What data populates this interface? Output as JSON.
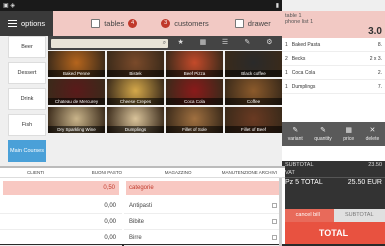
{
  "topnav": {
    "options": "options",
    "tables": "tables",
    "customers": "customers",
    "drawer": "drawer",
    "tables_badge": "4",
    "customers_badge": "3"
  },
  "categories": [
    "Beer",
    "Dessert",
    "Drink",
    "Fish",
    "Main Courses"
  ],
  "products": [
    {
      "label": "Baked Penne",
      "color": "#b5651d"
    },
    {
      "label": "Bistek",
      "color": "#7a4a2a"
    },
    {
      "label": "Beef Pizza",
      "color": "#c44a2a"
    },
    {
      "label": "Black coffee",
      "color": "#2a2a2a"
    },
    {
      "label": "Chateau de Mercurey",
      "color": "#5a1a1a"
    },
    {
      "label": "Cheese Crepes",
      "color": "#d4a84a"
    },
    {
      "label": "Coca Cola",
      "color": "#8a1a1a"
    },
    {
      "label": "Coffee",
      "color": "#8b5a2b"
    },
    {
      "label": "Dry Sparkling Wine",
      "color": "#c9b48a"
    },
    {
      "label": "Dumplings",
      "color": "#d9c39a"
    },
    {
      "label": "Fillet of Sole",
      "color": "#a07040"
    },
    {
      "label": "Fillet of Beef",
      "color": "#6a3a22"
    }
  ],
  "receipt": {
    "table": "table 1",
    "phone": "phone list 1",
    "total_top": "3.0",
    "items": [
      {
        "qty": "1",
        "name": "Baked Pasta",
        "price": "8."
      },
      {
        "qty": "2",
        "name": "Becks",
        "price": "2 x 3."
      },
      {
        "qty": "1",
        "name": "Coca Cola",
        "price": "2."
      },
      {
        "qty": "1",
        "name": "Dumplings",
        "price": "7."
      }
    ],
    "actions": [
      "variant",
      "quantity",
      "price",
      "delete"
    ],
    "subtotal_label": "SUBTOTAL",
    "subtotal_value": "23.50",
    "vat_label": "VAT",
    "total_label": "Pz 5 TOTAL",
    "total_value": "25.50 EUR",
    "cancel_bill": "cancel bill",
    "subtotal_btn": "SUBTOTAL",
    "total_btn": "TOTAL"
  },
  "laptop": {
    "headers": [
      "CLIENTI",
      "BUONI PASTO",
      "MAGAZZINO",
      "MANUTENZIONE ARCHIVI"
    ],
    "search_value": "0,50",
    "numbers": [
      "0,00",
      "0,00",
      "0,00"
    ],
    "category_header": "categorie",
    "categories": [
      "Antipasti",
      "Bibite",
      "Birre"
    ]
  }
}
